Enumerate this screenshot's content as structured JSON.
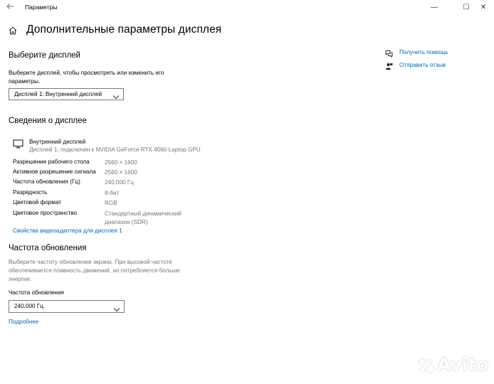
{
  "window": {
    "title": "Параметры",
    "minimize_glyph": "—",
    "maximize_glyph": "☐",
    "close_glyph": "✕"
  },
  "page": {
    "title": "Дополнительные параметры дисплея"
  },
  "choose_display": {
    "heading": "Выберите дисплей",
    "description": "Выберите дисплей, чтобы просмотреть или изменить его параметры.",
    "selected": "Дисплей 1: Внутренний дисплей"
  },
  "display_info": {
    "heading": "Сведения о дисплее",
    "monitor_name": "Внутренний дисплей",
    "monitor_subtitle": "Дисплей 1: подключен к NVIDIA GeForce RTX 4060 Laptop GPU",
    "rows": [
      {
        "label": "Разрешение рабочего стола",
        "value": "2560 × 1600"
      },
      {
        "label": "Активное разрешение сигнала",
        "value": "2560 × 1600"
      },
      {
        "label": "Частота обновления (Гц)",
        "value": "240,000 Гц"
      },
      {
        "label": "Разрядность",
        "value": "8-бит"
      },
      {
        "label": "Цветовой формат",
        "value": "RGB"
      },
      {
        "label": "Цветовое пространство",
        "value": "Стандартный динамический диапазон (SDR)"
      }
    ],
    "adapter_link": "Свойства видеоадаптера для дисплея 1"
  },
  "refresh_rate": {
    "heading": "Частота обновления",
    "description": "Выберите частоту обновления экрана. При высокой частоте обеспечивается плавность движений, но потребляется больше энергии.",
    "field_label": "Частота обновления",
    "selected": "240,000 Гц",
    "more_link": "Подробнее"
  },
  "sidebar": {
    "help_link": "Получить помощь",
    "feedback_link": "Отправить отзыв"
  },
  "watermark": {
    "text": "Avito"
  },
  "icons": [
    "back-icon",
    "home-icon",
    "monitor-icon",
    "chevron-down-icon",
    "help-icon",
    "feedback-icon",
    "avito-logo-icon"
  ],
  "colors": {
    "accent": "#0067b8",
    "muted_text": "#767676"
  }
}
